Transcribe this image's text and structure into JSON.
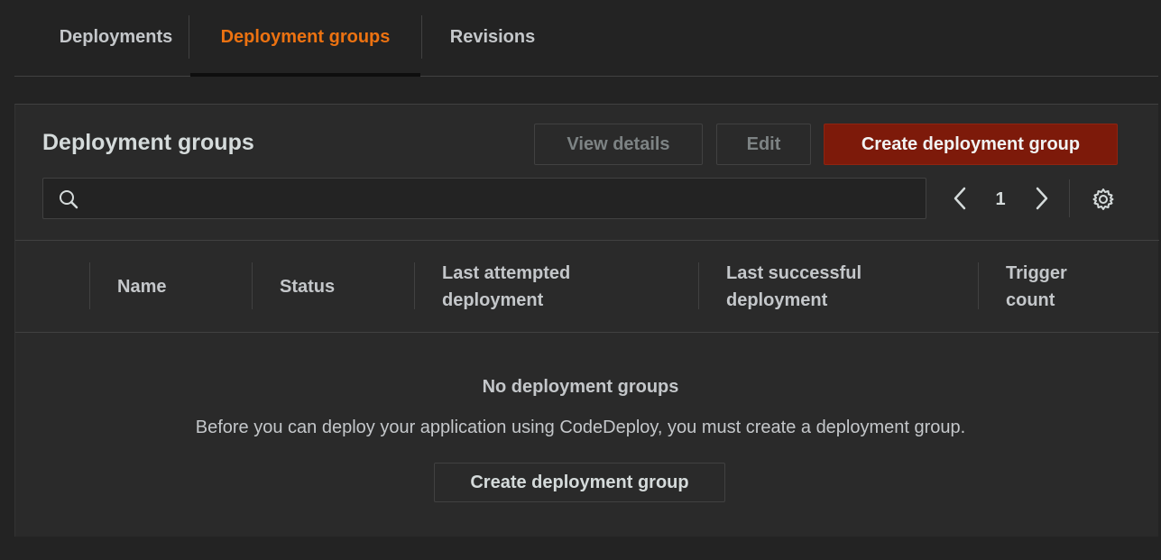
{
  "tabs": [
    {
      "label": "Deployments",
      "active": false
    },
    {
      "label": "Deployment groups",
      "active": true
    },
    {
      "label": "Revisions",
      "active": false
    }
  ],
  "panel": {
    "title": "Deployment groups",
    "buttons": {
      "view_details": "View details",
      "edit": "Edit",
      "create": "Create deployment group"
    },
    "search": {
      "placeholder": "",
      "icon": "search-icon"
    },
    "pagination": {
      "current_page": "1"
    },
    "settings_icon": "gear-icon"
  },
  "table": {
    "columns": [
      "Name",
      "Status",
      "Last attempted deployment",
      "Last successful deployment",
      "Trigger count"
    ],
    "column_lines": {
      "last_attempted": [
        "Last attempted",
        "deployment"
      ],
      "last_successful": [
        "Last successful",
        "deployment"
      ],
      "trigger": [
        "Trigger",
        "count"
      ]
    }
  },
  "empty_state": {
    "title": "No deployment groups",
    "description": "Before you can deploy your application using CodeDeploy, you must create a deployment group.",
    "button": "Create deployment group"
  },
  "colors": {
    "background": "#232323",
    "panel": "#2a2a2a",
    "active_tab": "#ec7211",
    "primary_button": "#7d1a0a",
    "border": "#414141"
  }
}
